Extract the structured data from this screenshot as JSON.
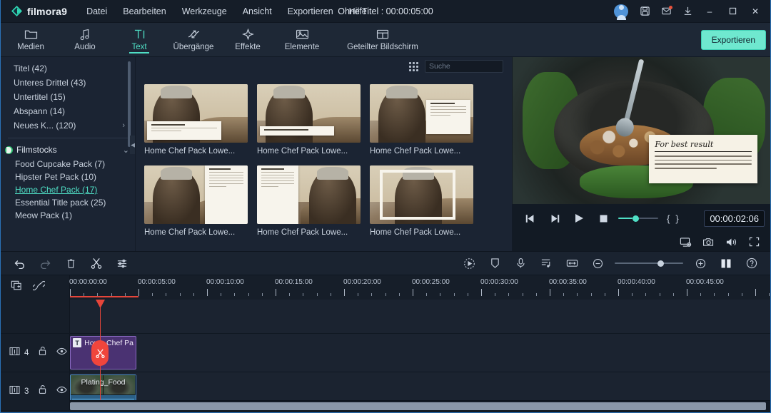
{
  "app": {
    "brand": "filmora9",
    "project_title": "Ohne Titel : 00:00:05:00",
    "accent": "#4fdfc5",
    "playhead_red": "#e6453a"
  },
  "menu": {
    "items": [
      {
        "label": "Datei"
      },
      {
        "label": "Bearbeiten"
      },
      {
        "label": "Werkzeuge"
      },
      {
        "label": "Ansicht"
      },
      {
        "label": "Exportieren"
      },
      {
        "label": "Hilfe"
      }
    ]
  },
  "titlebar_icons": [
    {
      "name": "account-avatar",
      "glyph": ""
    },
    {
      "name": "save-icon",
      "glyph": "ὋE"
    },
    {
      "name": "mail-icon",
      "glyph": ""
    },
    {
      "name": "download-icon",
      "glyph": ""
    }
  ],
  "window_controls": {
    "minimize": "–",
    "maximize": "☐",
    "close": "✕"
  },
  "tabs": [
    {
      "label": "Medien",
      "icon": "folder-icon",
      "active": false
    },
    {
      "label": "Audio",
      "icon": "music-note-icon",
      "active": false
    },
    {
      "label": "Text",
      "icon": "text-icon",
      "active": true
    },
    {
      "label": "Übergänge",
      "icon": "transition-icon",
      "active": false
    },
    {
      "label": "Effekte",
      "icon": "star-effect-icon",
      "active": false
    },
    {
      "label": "Elemente",
      "icon": "image-icon",
      "active": false
    },
    {
      "label": "Geteilter Bildschirm",
      "icon": "split-screen-icon",
      "active": false
    }
  ],
  "export_button": "Exportieren",
  "library": {
    "categories": [
      {
        "label": "Titel (42)",
        "has_arrow": false
      },
      {
        "label": "Unteres Drittel (43)",
        "has_arrow": false
      },
      {
        "label": "Untertitel (15)",
        "has_arrow": false
      },
      {
        "label": "Abspann (14)",
        "has_arrow": false
      },
      {
        "label": "Neues K... (120)",
        "has_arrow": true
      }
    ],
    "group": {
      "label": "Filmstocks",
      "packs": [
        {
          "label": "Food Cupcake Pack (7)",
          "selected": false
        },
        {
          "label": "Hipster Pet Pack (10)",
          "selected": false
        },
        {
          "label": "Home Chef Pack (17)",
          "selected": true
        },
        {
          "label": "Essential Title pack (25)",
          "selected": false
        },
        {
          "label": "Meow Pack (1)",
          "selected": false
        }
      ]
    },
    "search": {
      "placeholder": "Suche",
      "value": ""
    },
    "thumbnails": [
      {
        "label": "Home Chef Pack Lowe...",
        "note": "bottom-wide"
      },
      {
        "label": "Home Chef Pack Lowe...",
        "note": "bottom-thin"
      },
      {
        "label": "Home Chef Pack Lowe...",
        "note": "corner-block"
      },
      {
        "label": "Home Chef Pack Lowe...",
        "note": "right-tall"
      },
      {
        "label": "Home Chef Pack Lowe...",
        "note": "left-tall"
      },
      {
        "label": "Home Chef Pack Lowe...",
        "note": "frame"
      }
    ]
  },
  "preview": {
    "note_title": "For best result",
    "timecode": "00:00:02:06",
    "controls": [
      {
        "name": "prev-frame-button",
        "glyph": "◀|"
      },
      {
        "name": "next-frame-button",
        "glyph": "|▶"
      },
      {
        "name": "play-button",
        "glyph": "▶"
      },
      {
        "name": "stop-button",
        "glyph": "■"
      }
    ],
    "mark_in": "{",
    "mark_out": "}",
    "bottom_icons": [
      {
        "name": "display-settings-icon"
      },
      {
        "name": "snapshot-camera-icon"
      },
      {
        "name": "volume-icon"
      },
      {
        "name": "fullscreen-icon"
      }
    ]
  },
  "timeline_toolbar": {
    "left": [
      {
        "name": "undo-button",
        "glyph": "↶",
        "dim": false
      },
      {
        "name": "redo-button",
        "glyph": "↷",
        "dim": true
      },
      {
        "name": "delete-button",
        "glyph": "Ὕ1",
        "dim": false
      },
      {
        "name": "split-scissors-button",
        "glyph": "✂",
        "dim": false
      },
      {
        "name": "adjust-settings-button",
        "glyph": "☲",
        "dim": false
      }
    ],
    "right": [
      {
        "name": "speed-button"
      },
      {
        "name": "crop-button"
      },
      {
        "name": "voiceover-button"
      },
      {
        "name": "detach-audio-button"
      },
      {
        "name": "fit-timeline-button"
      },
      {
        "name": "zoom-out-button"
      },
      {
        "name": "zoom-in-button"
      },
      {
        "name": "split-view-button"
      },
      {
        "name": "help-button"
      }
    ]
  },
  "timeline": {
    "header_icons": [
      {
        "name": "add-track-icon"
      },
      {
        "name": "link-clips-icon"
      }
    ],
    "ruler_labels": [
      "00:00:00:00",
      "00:00:05:00",
      "00:00:10:00",
      "00:00:15:00",
      "00:00:20:00",
      "00:00:25:00",
      "00:00:30:00",
      "00:00:35:00",
      "00:00:40:00",
      "00:00:45:00"
    ],
    "tracks": [
      {
        "number": "4",
        "type": "text",
        "clip_label": "Home Chef Pa",
        "clip_badge": "T",
        "lock_icon": "unlock-icon",
        "eye_icon": "eye-icon"
      },
      {
        "number": "3",
        "type": "video",
        "clip_label": "Plating_Food",
        "lock_icon": "unlock-icon",
        "eye_icon": "eye-icon"
      }
    ]
  }
}
